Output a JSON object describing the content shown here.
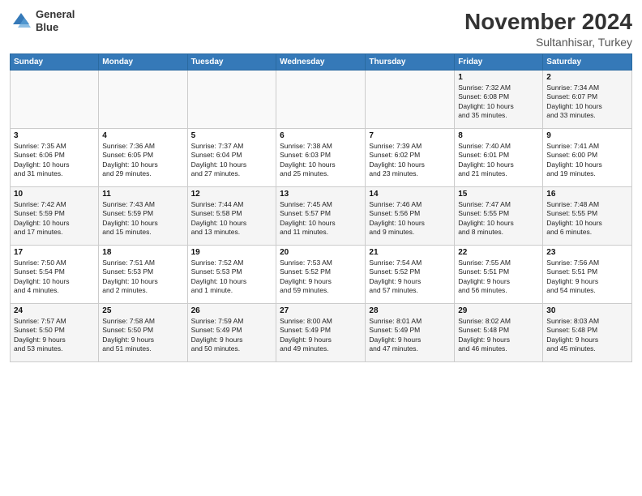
{
  "header": {
    "logo_line1": "General",
    "logo_line2": "Blue",
    "month": "November 2024",
    "location": "Sultanhisar, Turkey"
  },
  "weekdays": [
    "Sunday",
    "Monday",
    "Tuesday",
    "Wednesday",
    "Thursday",
    "Friday",
    "Saturday"
  ],
  "weeks": [
    [
      {
        "day": "",
        "info": ""
      },
      {
        "day": "",
        "info": ""
      },
      {
        "day": "",
        "info": ""
      },
      {
        "day": "",
        "info": ""
      },
      {
        "day": "",
        "info": ""
      },
      {
        "day": "1",
        "info": "Sunrise: 7:32 AM\nSunset: 6:08 PM\nDaylight: 10 hours\nand 35 minutes."
      },
      {
        "day": "2",
        "info": "Sunrise: 7:34 AM\nSunset: 6:07 PM\nDaylight: 10 hours\nand 33 minutes."
      }
    ],
    [
      {
        "day": "3",
        "info": "Sunrise: 7:35 AM\nSunset: 6:06 PM\nDaylight: 10 hours\nand 31 minutes."
      },
      {
        "day": "4",
        "info": "Sunrise: 7:36 AM\nSunset: 6:05 PM\nDaylight: 10 hours\nand 29 minutes."
      },
      {
        "day": "5",
        "info": "Sunrise: 7:37 AM\nSunset: 6:04 PM\nDaylight: 10 hours\nand 27 minutes."
      },
      {
        "day": "6",
        "info": "Sunrise: 7:38 AM\nSunset: 6:03 PM\nDaylight: 10 hours\nand 25 minutes."
      },
      {
        "day": "7",
        "info": "Sunrise: 7:39 AM\nSunset: 6:02 PM\nDaylight: 10 hours\nand 23 minutes."
      },
      {
        "day": "8",
        "info": "Sunrise: 7:40 AM\nSunset: 6:01 PM\nDaylight: 10 hours\nand 21 minutes."
      },
      {
        "day": "9",
        "info": "Sunrise: 7:41 AM\nSunset: 6:00 PM\nDaylight: 10 hours\nand 19 minutes."
      }
    ],
    [
      {
        "day": "10",
        "info": "Sunrise: 7:42 AM\nSunset: 5:59 PM\nDaylight: 10 hours\nand 17 minutes."
      },
      {
        "day": "11",
        "info": "Sunrise: 7:43 AM\nSunset: 5:59 PM\nDaylight: 10 hours\nand 15 minutes."
      },
      {
        "day": "12",
        "info": "Sunrise: 7:44 AM\nSunset: 5:58 PM\nDaylight: 10 hours\nand 13 minutes."
      },
      {
        "day": "13",
        "info": "Sunrise: 7:45 AM\nSunset: 5:57 PM\nDaylight: 10 hours\nand 11 minutes."
      },
      {
        "day": "14",
        "info": "Sunrise: 7:46 AM\nSunset: 5:56 PM\nDaylight: 10 hours\nand 9 minutes."
      },
      {
        "day": "15",
        "info": "Sunrise: 7:47 AM\nSunset: 5:55 PM\nDaylight: 10 hours\nand 8 minutes."
      },
      {
        "day": "16",
        "info": "Sunrise: 7:48 AM\nSunset: 5:55 PM\nDaylight: 10 hours\nand 6 minutes."
      }
    ],
    [
      {
        "day": "17",
        "info": "Sunrise: 7:50 AM\nSunset: 5:54 PM\nDaylight: 10 hours\nand 4 minutes."
      },
      {
        "day": "18",
        "info": "Sunrise: 7:51 AM\nSunset: 5:53 PM\nDaylight: 10 hours\nand 2 minutes."
      },
      {
        "day": "19",
        "info": "Sunrise: 7:52 AM\nSunset: 5:53 PM\nDaylight: 10 hours\nand 1 minute."
      },
      {
        "day": "20",
        "info": "Sunrise: 7:53 AM\nSunset: 5:52 PM\nDaylight: 9 hours\nand 59 minutes."
      },
      {
        "day": "21",
        "info": "Sunrise: 7:54 AM\nSunset: 5:52 PM\nDaylight: 9 hours\nand 57 minutes."
      },
      {
        "day": "22",
        "info": "Sunrise: 7:55 AM\nSunset: 5:51 PM\nDaylight: 9 hours\nand 56 minutes."
      },
      {
        "day": "23",
        "info": "Sunrise: 7:56 AM\nSunset: 5:51 PM\nDaylight: 9 hours\nand 54 minutes."
      }
    ],
    [
      {
        "day": "24",
        "info": "Sunrise: 7:57 AM\nSunset: 5:50 PM\nDaylight: 9 hours\nand 53 minutes."
      },
      {
        "day": "25",
        "info": "Sunrise: 7:58 AM\nSunset: 5:50 PM\nDaylight: 9 hours\nand 51 minutes."
      },
      {
        "day": "26",
        "info": "Sunrise: 7:59 AM\nSunset: 5:49 PM\nDaylight: 9 hours\nand 50 minutes."
      },
      {
        "day": "27",
        "info": "Sunrise: 8:00 AM\nSunset: 5:49 PM\nDaylight: 9 hours\nand 49 minutes."
      },
      {
        "day": "28",
        "info": "Sunrise: 8:01 AM\nSunset: 5:49 PM\nDaylight: 9 hours\nand 47 minutes."
      },
      {
        "day": "29",
        "info": "Sunrise: 8:02 AM\nSunset: 5:48 PM\nDaylight: 9 hours\nand 46 minutes."
      },
      {
        "day": "30",
        "info": "Sunrise: 8:03 AM\nSunset: 5:48 PM\nDaylight: 9 hours\nand 45 minutes."
      }
    ]
  ]
}
